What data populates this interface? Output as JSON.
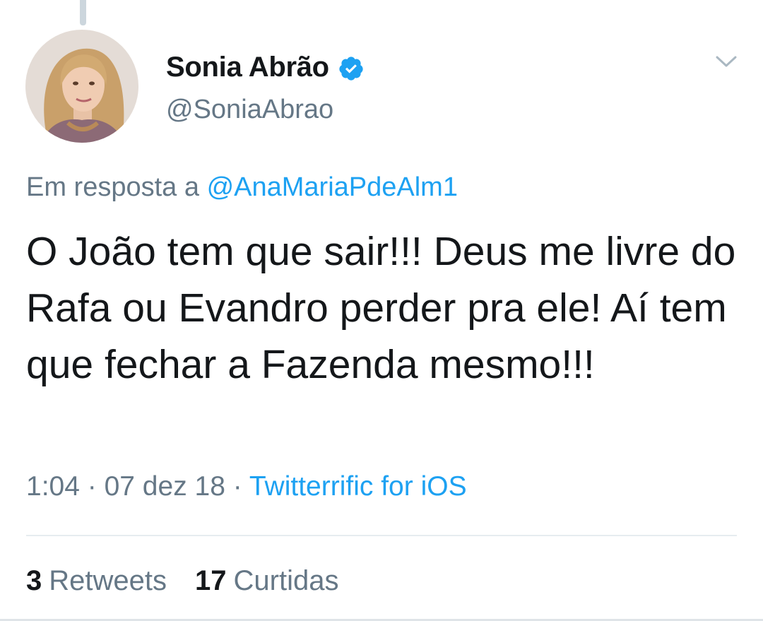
{
  "author": {
    "display_name": "Sonia Abrão",
    "handle": "@SoniaAbrao",
    "verified": true
  },
  "reply": {
    "prefix": "Em resposta a",
    "mention": "@AnaMariaPdeAlm1"
  },
  "tweet": {
    "text": "O João tem que sair!!! Deus me livre do Rafa ou Evandro perder pra ele! Aí tem que fechar a Fazenda mesmo!!!"
  },
  "meta": {
    "time": "1:04",
    "separator": "·",
    "date": "07 dez 18",
    "source": "Twitterrific for iOS"
  },
  "stats": {
    "retweets_count": "3",
    "retweets_label": "Retweets",
    "likes_count": "17",
    "likes_label": "Curtidas"
  },
  "icons": {
    "verified": "verified-badge-icon",
    "menu": "chevron-down-icon"
  },
  "colors": {
    "accent": "#1da1f2",
    "text_primary": "#14171a",
    "text_secondary": "#657786",
    "divider": "#e6ecf0"
  }
}
